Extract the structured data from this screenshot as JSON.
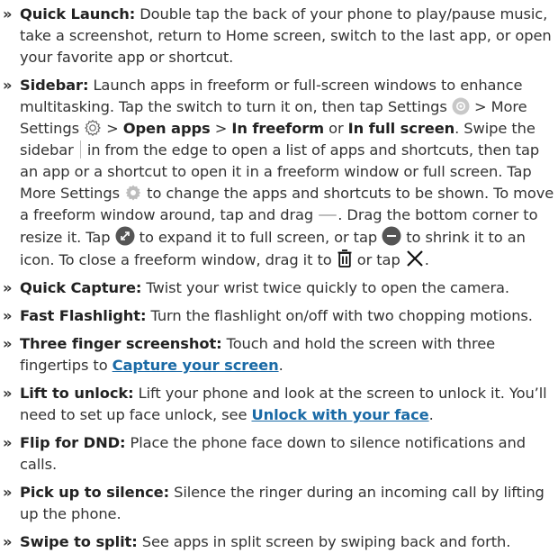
{
  "bullet": "»",
  "items": [
    {
      "term": "Quick Launch:",
      "text": " Double tap the back of your phone to play/pause music, take a screenshot, return to Home screen, switch to the last app, or open your favorite app or shortcut."
    },
    {
      "term": "Sidebar:",
      "t1": " Launch apps in freeform or full-screen windows to enhance multitasking. Tap the switch to turn it on, then tap Settings ",
      "t2": " > More Settings ",
      "t3": " > ",
      "b1": "Open apps",
      "t4": " > ",
      "b2": "In freeform",
      "t5": " or ",
      "b3": "In full screen",
      "t6": ". Swipe the sidebar ",
      "t7": " in from the edge to open a list of apps and shortcuts, then tap an app or a shortcut to open it in a freeform window or full screen. Tap More Settings ",
      "t8": " to change the apps and shortcuts to be shown. To move a freeform window around, tap and drag ",
      "t9": ". Drag the bottom corner to resize it. Tap ",
      "t10": " to expand it to full screen, or tap ",
      "t11": " to shrink it to an icon. To close a freeform window, drag it to ",
      "t12": " or tap ",
      "t13": "."
    },
    {
      "term": "Quick Capture:",
      "text": " Twist your wrist twice quickly to open the camera."
    },
    {
      "term": "Fast Flashlight:",
      "text": " Turn the flashlight on/off with two chopping motions."
    },
    {
      "term": "Three finger screenshot:",
      "text": " Touch and hold the screen with three fingertips to ",
      "link": "Capture your screen",
      "end": "."
    },
    {
      "term": "Lift to unlock:",
      "text": " Lift your phone and look at the screen to unlock it. You’ll need to set up face unlock, see ",
      "link": "Unlock with your face",
      "end": "."
    },
    {
      "term": "Flip for DND:",
      "text": " Place the phone face down to silence notifications and calls."
    },
    {
      "term": "Pick up to silence:",
      "text": " Silence the ringer during an incoming call by lifting up the phone."
    },
    {
      "term": "Swipe to split:",
      "text": " See apps in split screen by swiping back and forth."
    }
  ],
  "icons": {
    "settings_gray": "settings-circle-icon",
    "settings_outline": "gear-outline-icon",
    "settings_filled": "gear-filled-icon",
    "drag_handle": "drag-handle-icon",
    "expand": "expand-icon",
    "shrink": "minimize-icon",
    "trash": "trash-icon",
    "close": "close-icon"
  },
  "colors": {
    "link": "#1a6aa6",
    "text": "#333333",
    "icon_gray": "#bdbdbd"
  }
}
